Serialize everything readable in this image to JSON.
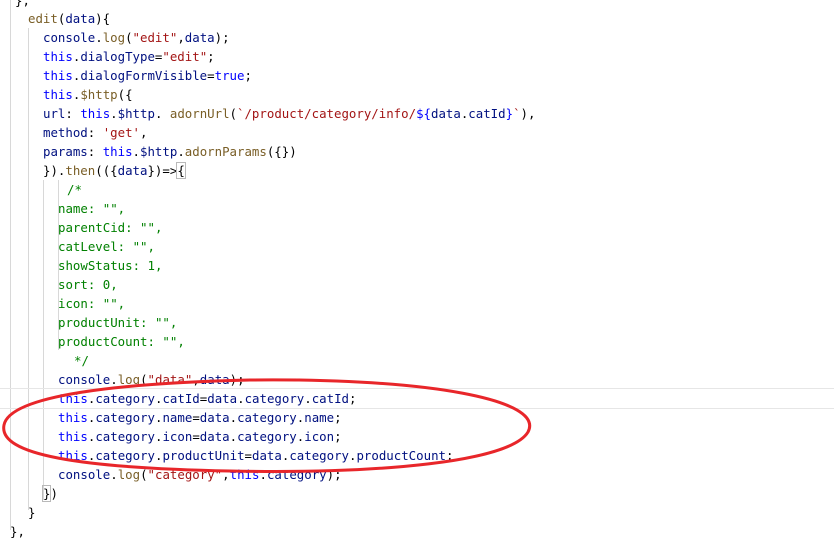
{
  "code": {
    "lines": [
      "},",
      "edit(data){",
      "console.log(\"edit\",data);",
      "this.dialogType=\"edit\";",
      "this.dialogFormVisible=true;",
      "this.$http({",
      "url: this.$http. adornUrl(`/product/category/info/${data.catId}`),",
      "method: 'get',",
      "params: this.$http.adornParams({})",
      "}).then(({data})=>{",
      "/*",
      "name: \"\",",
      "parentCid: \"\",",
      "catLevel: \"\",",
      "showStatus: 1,",
      "sort: 0,",
      "icon: \"\",",
      "productUnit: \"\",",
      "productCount: \"\",",
      "*/",
      "console.log(\"data\",data);",
      "this.category.catId=data.category.catId;",
      "this.category.name=data.category.name;",
      "this.category.icon=data.category.icon;",
      "this.category.productUnit=data.category.productCount;",
      "console.log(\"category\",this.category);",
      "})",
      "}",
      "},"
    ]
  },
  "annotation": {
    "color": "#e8262a"
  }
}
